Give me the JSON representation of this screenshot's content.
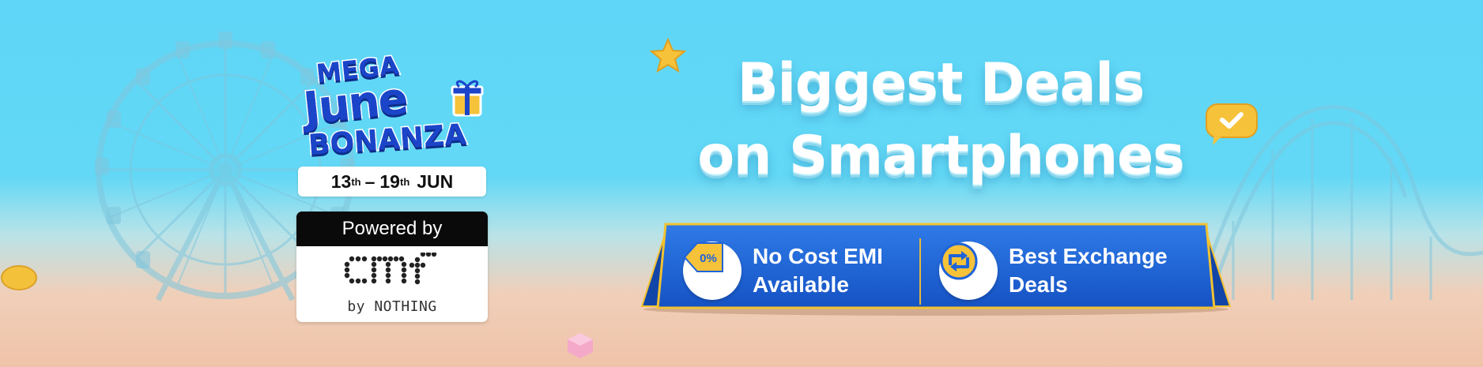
{
  "banner": {
    "logo": {
      "line1": "MEGA",
      "line2": "June",
      "line3": "BONANZA"
    },
    "dates": {
      "start_day": "13",
      "start_suffix": "th",
      "separator": "–",
      "end_day": "19",
      "end_suffix": "th",
      "month": "JUN"
    },
    "powered": {
      "label": "Powered by",
      "brand_sub": "by NOTHING"
    },
    "headline": {
      "line1": "Biggest Deals",
      "line2": "on Smartphones"
    },
    "features": [
      {
        "line1": "No Cost EMI",
        "line2": "Available",
        "badge": "0%",
        "icon": "zero-percent-tag-icon"
      },
      {
        "line1": "Best Exchange",
        "line2": "Deals",
        "icon": "exchange-arrows-icon"
      }
    ],
    "colors": {
      "sky": "#5fd6f7",
      "sand": "#efc3a9",
      "plaque_blue": "#1e63d8",
      "gold": "#f2c230",
      "logo_blue": "#1b45c9"
    }
  }
}
